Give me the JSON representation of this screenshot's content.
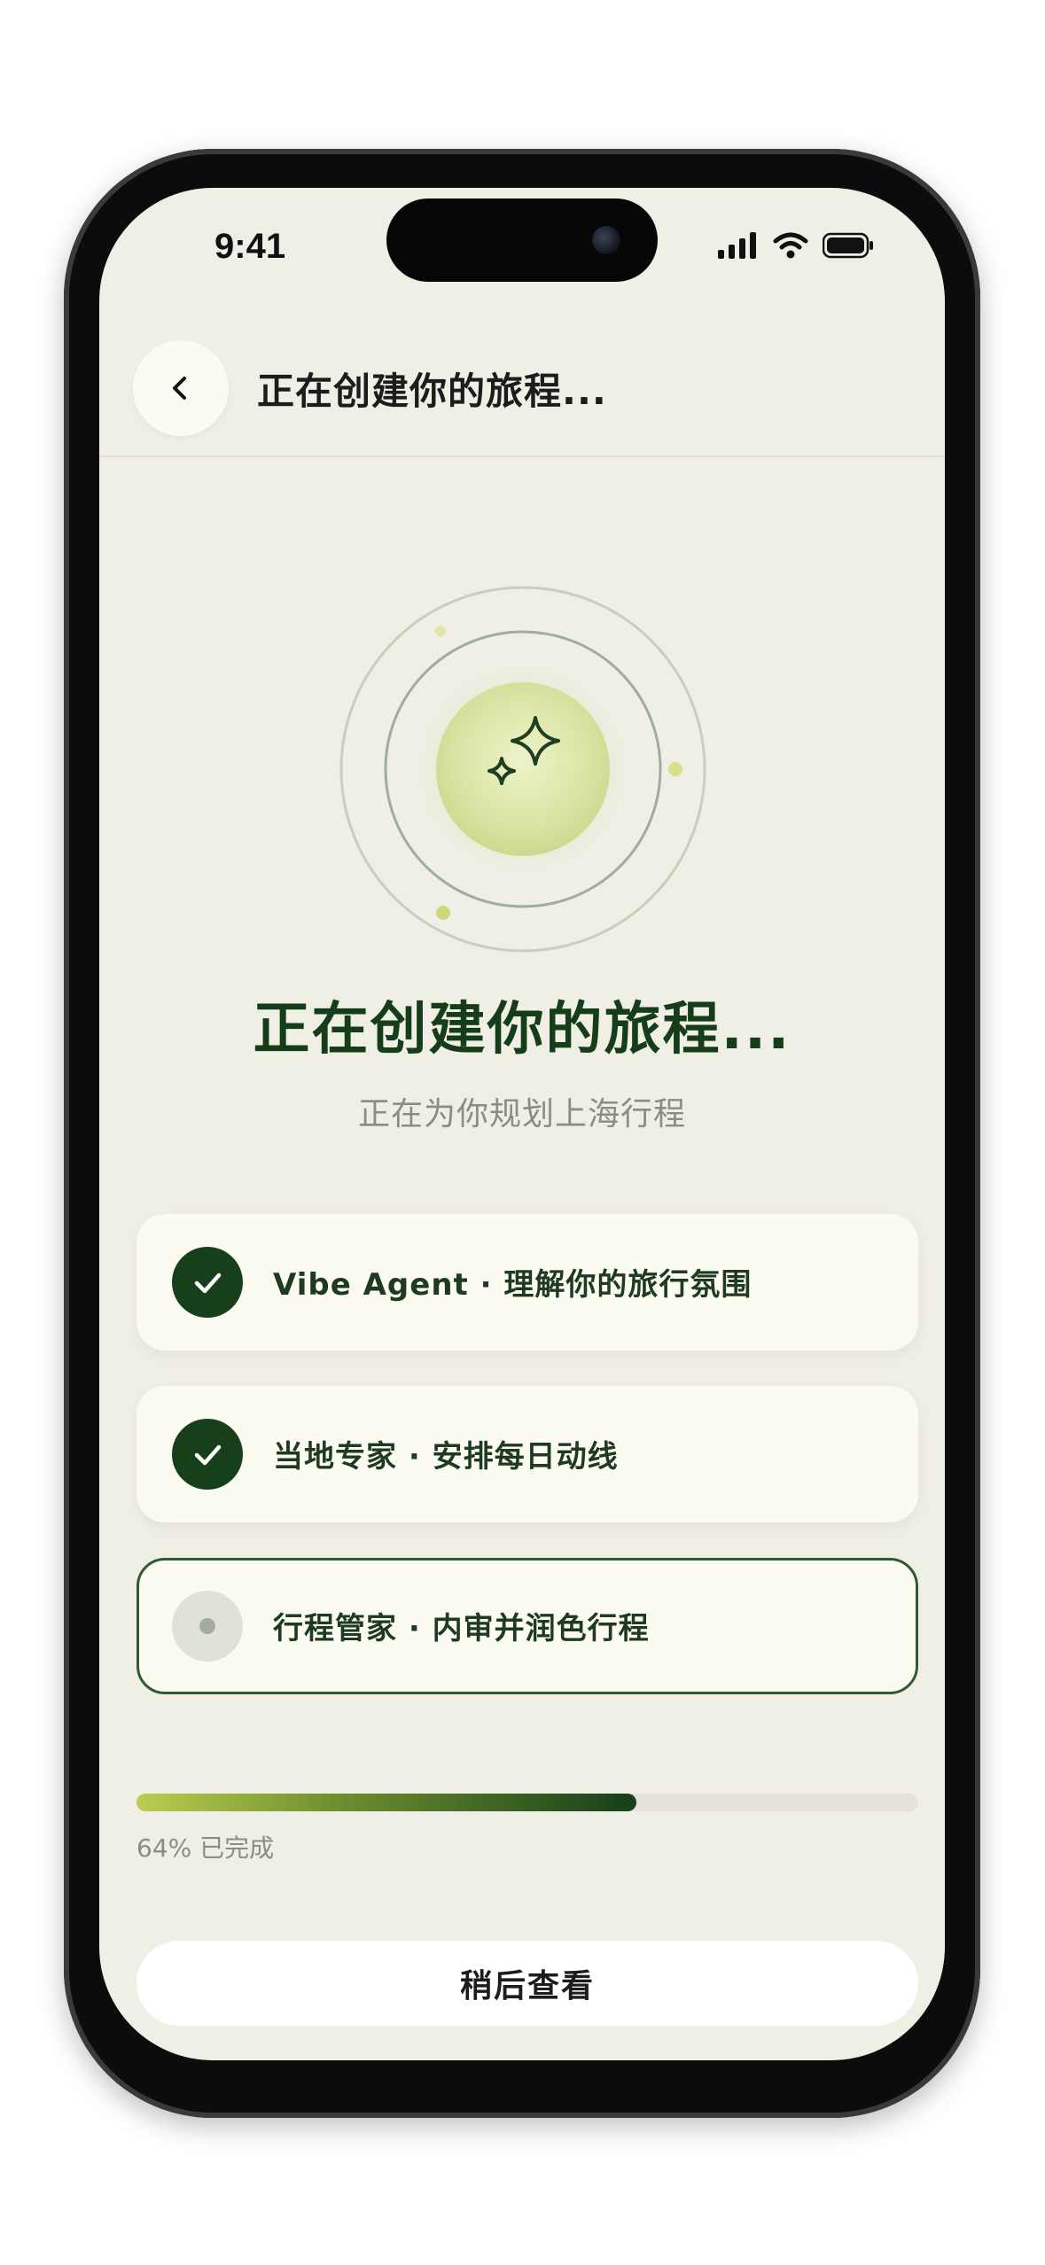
{
  "status_bar": {
    "time": "9:41",
    "icons": [
      "cellular-signal-icon",
      "wifi-icon",
      "battery-icon"
    ]
  },
  "header": {
    "back_icon": "chevron-left-icon",
    "title": "正在创建你的旅程..."
  },
  "hero": {
    "icon": "sparkles-icon",
    "title": "正在创建你的旅程...",
    "subtitle": "正在为你规划上海行程"
  },
  "steps": [
    {
      "label": "Vibe Agent · 理解你的旅行氛围",
      "status": "done"
    },
    {
      "label": "当地专家 · 安排每日动线",
      "status": "done"
    },
    {
      "label": "行程管家 · 内审并润色行程",
      "status": "in-progress"
    }
  ],
  "progress": {
    "value_percent": 64,
    "text": "64% 已完成"
  },
  "footer": {
    "later_label": "稍后查看"
  },
  "colors": {
    "background": "#f0efe6",
    "primary_green": "#163f1a",
    "accent_lime": "#bccd50",
    "card": "#fbfbf2",
    "muted_text": "#8c8c84"
  }
}
